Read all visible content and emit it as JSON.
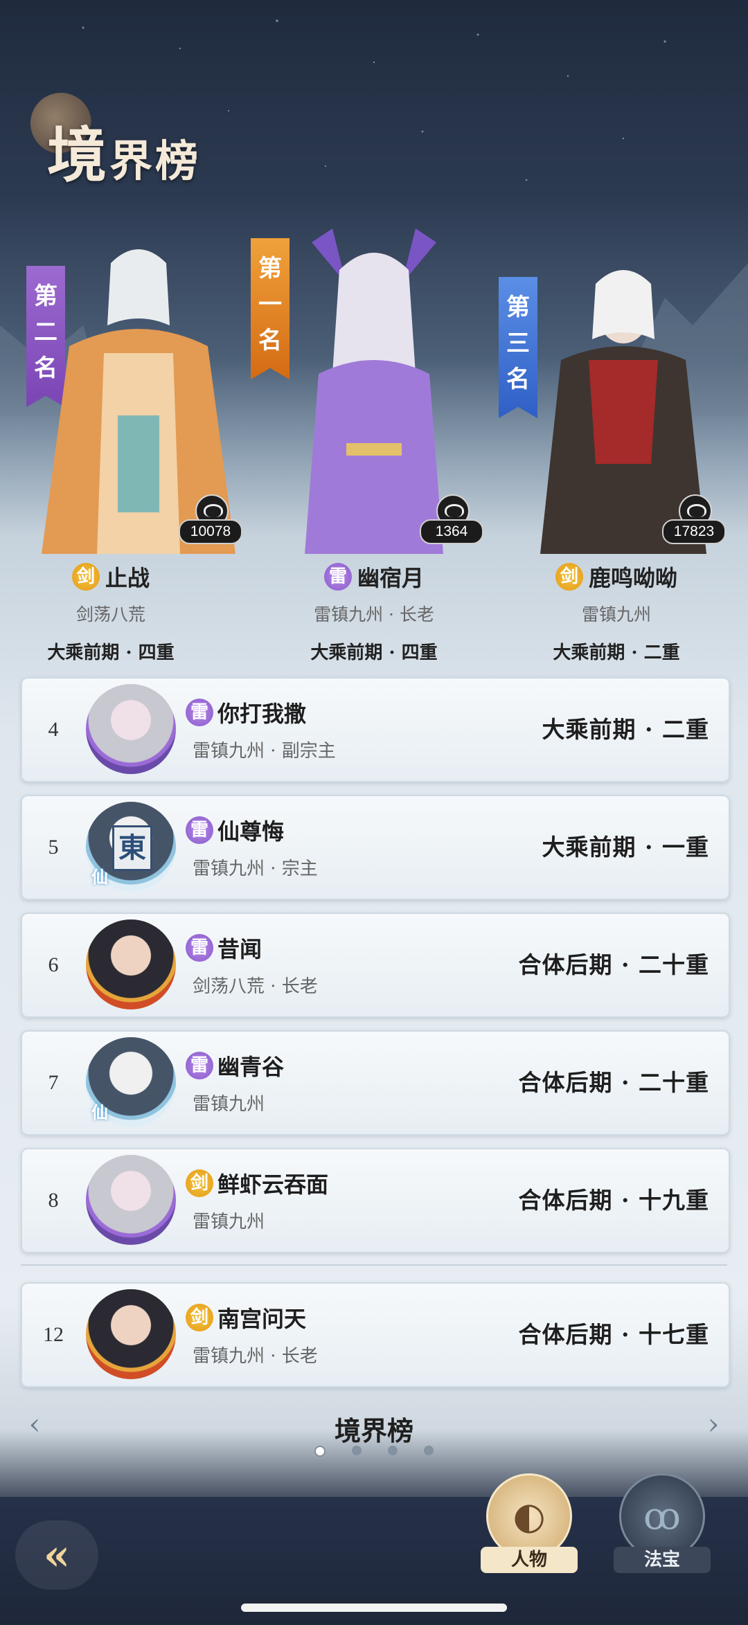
{
  "header": {
    "title_big": "境",
    "title_rest": "界榜"
  },
  "podium": [
    {
      "banner": [
        "第",
        "二",
        "名"
      ],
      "banner_color": "#8a58c8",
      "score": "10078",
      "sect": "剑",
      "sect_color": "#e9a11a",
      "name": "止战",
      "sub": "剑荡八荒",
      "realm": "大乘前期 · 四重"
    },
    {
      "banner": [
        "第",
        "一",
        "名"
      ],
      "banner_color": "#e2801f",
      "score": "1364",
      "sect": "雷",
      "sect_color": "#9a6ad8",
      "name": "幽宿月",
      "sub": "雷镇九州 · 长老",
      "realm": "大乘前期 · 四重"
    },
    {
      "banner": [
        "第",
        "三",
        "名"
      ],
      "banner_color": "#3f72d6",
      "score": "17823",
      "sect": "剑",
      "sect_color": "#e9a11a",
      "name": "鹿鸣呦呦",
      "sub": "雷镇九州",
      "realm": "大乘前期 · 二重"
    }
  ],
  "list": [
    {
      "rank": "4",
      "sect": "雷",
      "name": "你打我撒",
      "sub": "雷镇九州 · 副宗主",
      "realm": "大乘前期 · 二重"
    },
    {
      "rank": "5",
      "sect": "雷",
      "name": "仙尊悔",
      "sub": "雷镇九州 · 宗主",
      "realm": "大乘前期 · 一重",
      "avatar_glyph": "東",
      "avatar_tag": "仙"
    },
    {
      "rank": "6",
      "sect": "雷",
      "name": "昔闻",
      "sub": "剑荡八荒 · 长老",
      "realm": "合体后期 · 二十重"
    },
    {
      "rank": "7",
      "sect": "雷",
      "name": "幽青谷",
      "sub": "雷镇九州",
      "realm": "合体后期 · 二十重",
      "avatar_tag": "仙"
    },
    {
      "rank": "8",
      "sect": "剑",
      "name": "鲜虾云吞面",
      "sub": "雷镇九州",
      "realm": "合体后期 · 十九重"
    }
  ],
  "self_entry": {
    "rank": "12",
    "sect": "剑",
    "name": "南宫问天",
    "sub": "雷镇九州 · 长老",
    "realm": "合体后期 · 十七重"
  },
  "pager": {
    "label": "境界榜",
    "pages": 4,
    "current": 1,
    "prev_icon": "chevron-left-icon",
    "next_icon": "chevron-right-icon"
  },
  "bottom": {
    "back_icon": "back-arrow-icon",
    "tabs": [
      {
        "label": "人物",
        "icon": "character-icon",
        "active": true
      },
      {
        "label": "法宝",
        "icon": "gourd-icon",
        "active": false
      }
    ]
  },
  "colors": {
    "sect_lei": "#9a6ad8",
    "sect_jian": "#e9a11a"
  }
}
